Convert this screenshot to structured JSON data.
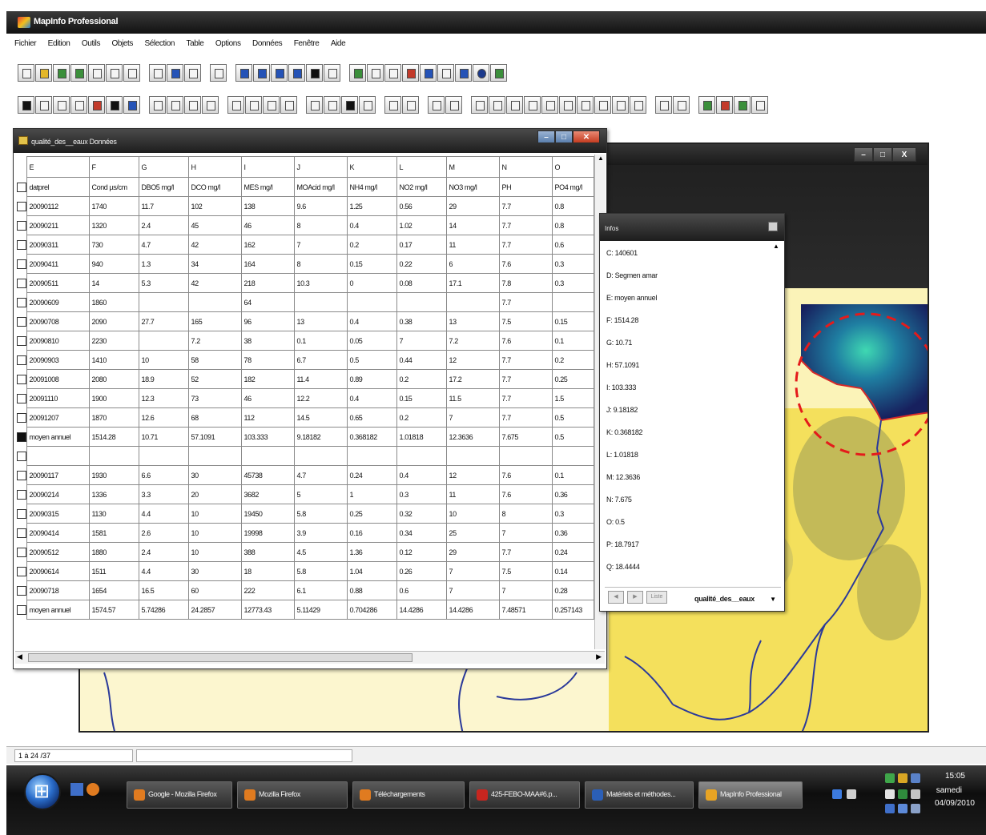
{
  "app": {
    "title": "MapInfo Professional",
    "menu": [
      "Fichier",
      "Edition",
      "Outils",
      "Objets",
      "Sélection",
      "Table",
      "Options",
      "Données",
      "Fenêtre",
      "Aide"
    ]
  },
  "table_window": {
    "title": "qualité_des__eaux Données",
    "columns": [
      "E",
      "F",
      "G",
      "H",
      "I",
      "J",
      "K",
      "L",
      "M",
      "N",
      "O"
    ],
    "rows": [
      {
        "selected": false,
        "cells": [
          "datprel",
          "Cond µs/cm",
          "DBO5 mg/l",
          "DCO mg/l",
          "MES mg/l",
          "MOAcid mg/l",
          "NH4 mg/l",
          "NO2 mg/l",
          "NO3 mg/l",
          "PH",
          "PO4 mg/l"
        ]
      },
      {
        "selected": false,
        "cells": [
          "20090112",
          "1740",
          "11.7",
          "102",
          "138",
          "9.6",
          "1.25",
          "0.56",
          "29",
          "7.7",
          "0.8"
        ]
      },
      {
        "selected": false,
        "cells": [
          "20090211",
          "1320",
          "2.4",
          "45",
          "46",
          "8",
          "0.4",
          "1.02",
          "14",
          "7.7",
          "0.8"
        ]
      },
      {
        "selected": false,
        "cells": [
          "20090311",
          "730",
          "4.7",
          "42",
          "162",
          "7",
          "0.2",
          "0.17",
          "11",
          "7.7",
          "0.6"
        ]
      },
      {
        "selected": false,
        "cells": [
          "20090411",
          "940",
          "1.3",
          "34",
          "164",
          "8",
          "0.15",
          "0.22",
          "6",
          "7.6",
          "0.3"
        ]
      },
      {
        "selected": false,
        "cells": [
          "20090511",
          "14",
          "5.3",
          "42",
          "218",
          "10.3",
          "0",
          "0.08",
          "17.1",
          "7.8",
          "0.3"
        ]
      },
      {
        "selected": false,
        "cells": [
          "20090609",
          "1860",
          "",
          "",
          "64",
          "",
          "",
          "",
          "",
          "7.7",
          ""
        ]
      },
      {
        "selected": false,
        "cells": [
          "20090708",
          "2090",
          "27.7",
          "165",
          "96",
          "13",
          "0.4",
          "0.38",
          "13",
          "7.5",
          "0.15"
        ]
      },
      {
        "selected": false,
        "cells": [
          "20090810",
          "2230",
          "",
          "7.2",
          "38",
          "0.1",
          "0.05",
          "7",
          "7.2",
          "7.6",
          "0.1"
        ]
      },
      {
        "selected": false,
        "cells": [
          "20090903",
          "1410",
          "10",
          "58",
          "78",
          "6.7",
          "0.5",
          "0.44",
          "12",
          "7.7",
          "0.2"
        ]
      },
      {
        "selected": false,
        "cells": [
          "20091008",
          "2080",
          "18.9",
          "52",
          "182",
          "11.4",
          "0.89",
          "0.2",
          "17.2",
          "7.7",
          "0.25"
        ]
      },
      {
        "selected": false,
        "cells": [
          "20091110",
          "1900",
          "12.3",
          "73",
          "46",
          "12.2",
          "0.4",
          "0.15",
          "11.5",
          "7.7",
          "1.5"
        ]
      },
      {
        "selected": false,
        "cells": [
          "20091207",
          "1870",
          "12.6",
          "68",
          "112",
          "14.5",
          "0.65",
          "0.2",
          "7",
          "7.7",
          "0.5"
        ]
      },
      {
        "selected": true,
        "cells": [
          "moyen annuel",
          "1514.28",
          "10.71",
          "57.1091",
          "103.333",
          "9.18182",
          "0.368182",
          "1.01818",
          "12.3636",
          "7.675",
          "0.5"
        ]
      },
      {
        "selected": false,
        "cells": [
          "",
          "",
          "",
          "",
          "",
          "",
          "",
          "",
          "",
          "",
          ""
        ]
      },
      {
        "selected": false,
        "cells": [
          "20090117",
          "1930",
          "6.6",
          "30",
          "45738",
          "4.7",
          "0.24",
          "0.4",
          "12",
          "7.6",
          "0.1"
        ]
      },
      {
        "selected": false,
        "cells": [
          "20090214",
          "1336",
          "3.3",
          "20",
          "3682",
          "5",
          "1",
          "0.3",
          "11",
          "7.6",
          "0.36"
        ]
      },
      {
        "selected": false,
        "cells": [
          "20090315",
          "1130",
          "4.4",
          "10",
          "19450",
          "5.8",
          "0.25",
          "0.32",
          "10",
          "8",
          "0.3"
        ]
      },
      {
        "selected": false,
        "cells": [
          "20090414",
          "1581",
          "2.6",
          "10",
          "19998",
          "3.9",
          "0.16",
          "0.34",
          "25",
          "7",
          "0.36"
        ]
      },
      {
        "selected": false,
        "cells": [
          "20090512",
          "1880",
          "2.4",
          "10",
          "388",
          "4.5",
          "1.36",
          "0.12",
          "29",
          "7.7",
          "0.24"
        ]
      },
      {
        "selected": false,
        "cells": [
          "20090614",
          "1511",
          "4.4",
          "30",
          "18",
          "5.8",
          "1.04",
          "0.26",
          "7",
          "7.5",
          "0.14"
        ]
      },
      {
        "selected": false,
        "cells": [
          "20090718",
          "1654",
          "16.5",
          "60",
          "222",
          "6.1",
          "0.88",
          "0.6",
          "7",
          "7",
          "0.28"
        ]
      },
      {
        "selected": false,
        "cells": [
          "moyen annuel",
          "1574.57",
          "5.74286",
          "24.2857",
          "12773.43",
          "5.11429",
          "0.704286",
          "14.4286",
          "14.4286",
          "7.48571",
          "0.257143"
        ]
      }
    ]
  },
  "info_window": {
    "title": "Infos",
    "rows": [
      "C: 140601",
      "D: Segmen amar",
      "E: moyen annuel",
      "F: 1514.28",
      "G: 10.71",
      "H: 57.1091",
      "I: 103.333",
      "J: 9.18182",
      "K: 0.368182",
      "L: 1.01818",
      "M: 12.3636",
      "N: 7.675",
      "O: 0.5",
      "P: 18.7917",
      "Q: 18.4444"
    ],
    "footer_label": "qualité_des__eaux",
    "list_button": "Liste"
  },
  "status": {
    "record": "1 à 24 /37"
  },
  "taskbar": {
    "tasks": [
      {
        "label": "Google - Mozilla Firefox",
        "color": "#e07b20"
      },
      {
        "label": "Mozilla Firefox",
        "color": "#e07b20"
      },
      {
        "label": "Téléchargements",
        "color": "#e07b20"
      },
      {
        "label": "425-FEBO-MAA#6.p...",
        "color": "#c8261f"
      },
      {
        "label": "Matériels et méthodes...",
        "color": "#2b5fb7"
      },
      {
        "label": "MapInfo Professional",
        "color": "#e8a424"
      }
    ],
    "clock_time": "15:05",
    "clock_day": "samedi",
    "clock_date": "04/09/2010"
  }
}
